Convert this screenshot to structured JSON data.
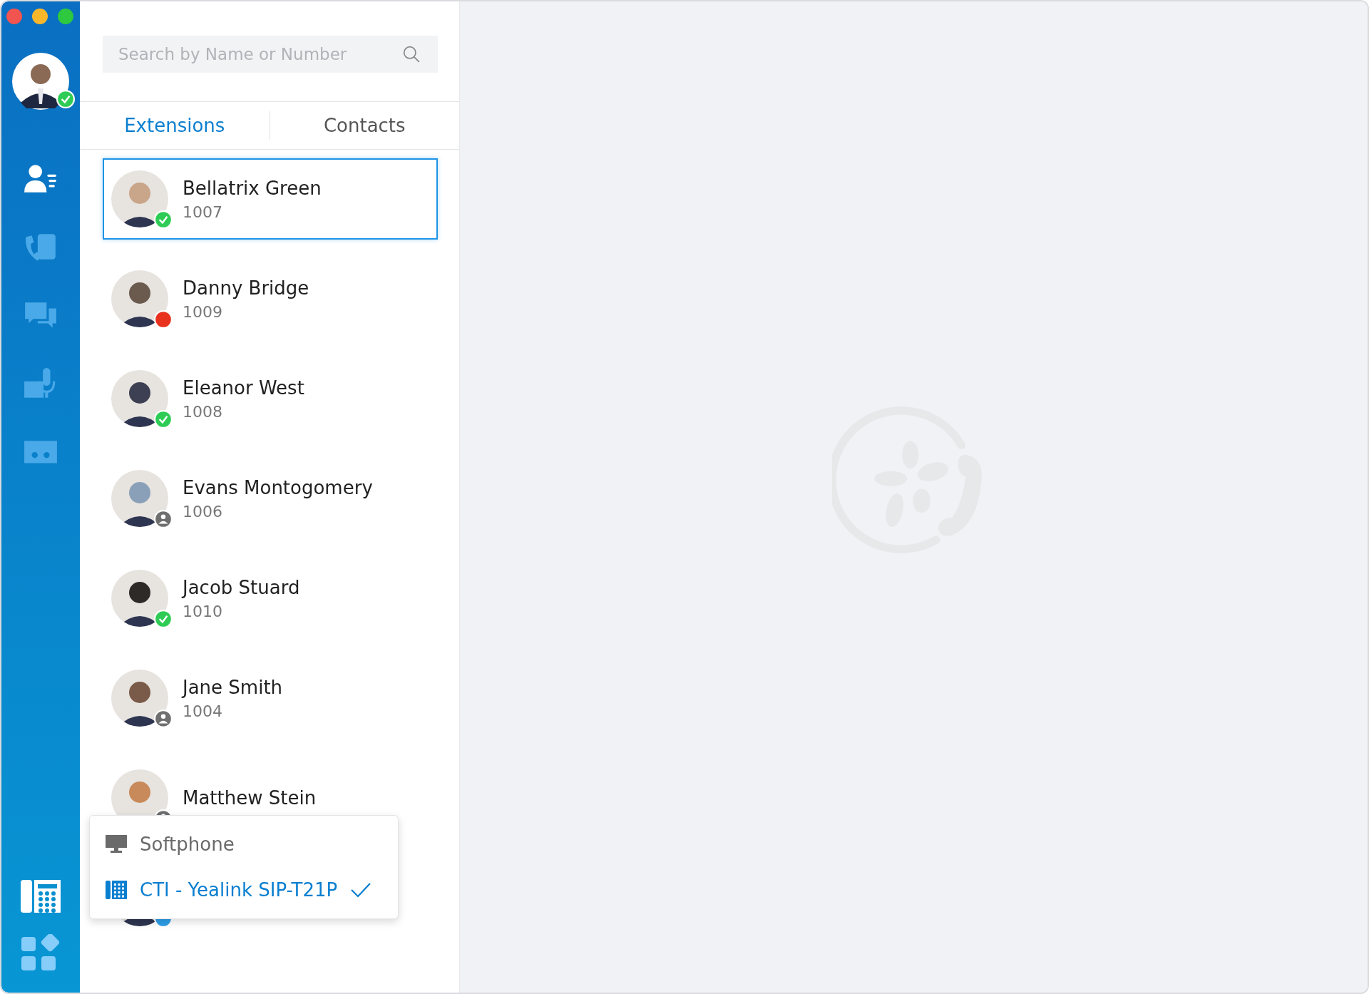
{
  "user": {
    "badge": {
      "kind": "available"
    }
  },
  "nav": [
    {
      "kind": "contacts",
      "selected": true
    },
    {
      "kind": "calllog",
      "selected": false
    },
    {
      "kind": "chat",
      "selected": false
    },
    {
      "kind": "voicemail",
      "selected": false
    },
    {
      "kind": "recording",
      "selected": false
    }
  ],
  "bottom_nav": [
    {
      "kind": "deskphone"
    },
    {
      "kind": "apps"
    }
  ],
  "search": {
    "placeholder": "Search by Name or Number"
  },
  "tabs": [
    {
      "label": "Extensions",
      "selected": true
    },
    {
      "label": "Contacts",
      "selected": false
    }
  ],
  "extensions": [
    {
      "name": "Bellatrix Green",
      "number": "1007",
      "badge": {
        "kind": "available"
      },
      "selected": true
    },
    {
      "name": "Danny Bridge",
      "number": "1009",
      "badge": {
        "kind": "busy"
      },
      "selected": false
    },
    {
      "name": "Eleanor West",
      "number": "1008",
      "badge": {
        "kind": "available"
      },
      "selected": false
    },
    {
      "name": "Evans Montogomery",
      "number": "1006",
      "badge": {
        "kind": "offline"
      },
      "selected": false
    },
    {
      "name": "Jacob Stuard",
      "number": "1010",
      "badge": {
        "kind": "available"
      },
      "selected": false
    },
    {
      "name": "Jane Smith",
      "number": "1004",
      "badge": {
        "kind": "offline"
      },
      "selected": false
    },
    {
      "name": "Matthew Stein",
      "badge": {
        "kind": "offline"
      },
      "selected": false
    },
    {
      "badge": {
        "kind": "away"
      },
      "selected": false
    }
  ],
  "device_menu": [
    {
      "label": "Softphone",
      "kind": "monitor",
      "selected": false
    },
    {
      "label": "CTI - Yealink SIP-T21P",
      "kind": "deskphone",
      "selected": true
    }
  ]
}
